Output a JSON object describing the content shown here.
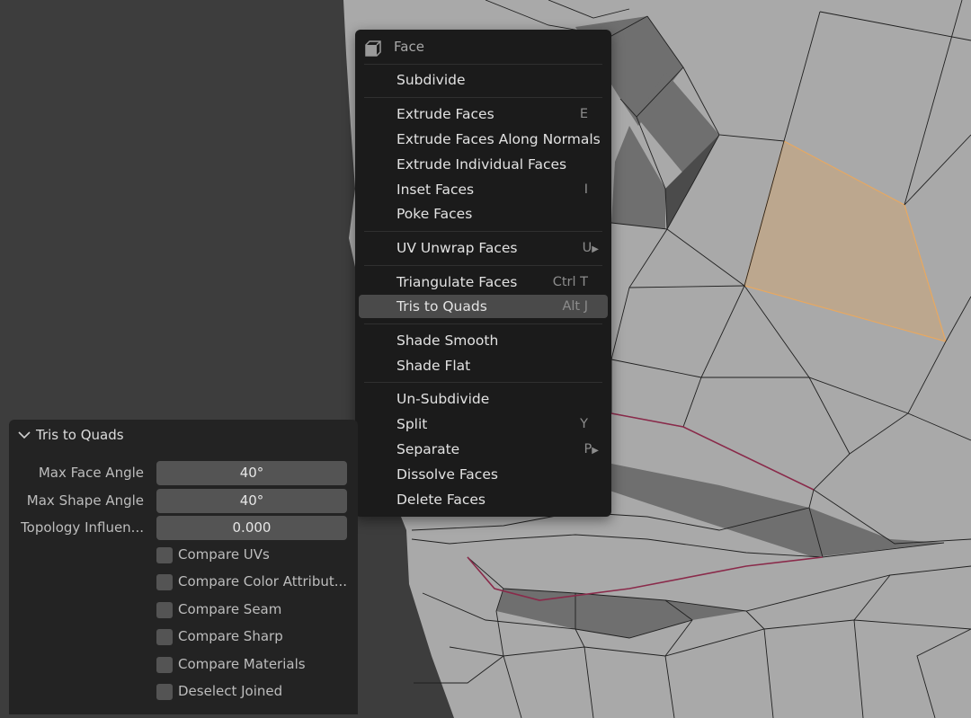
{
  "colors": {
    "viewport_bg": "#3d3d3d",
    "mesh_face": "#a9a9a9",
    "mesh_edge": "#202020",
    "selected_face": "#bca78e",
    "selected_edge": "#e8a860",
    "seam_edge": "#8a2a4a",
    "menu_bg": "#1b1b1b",
    "menu_highlight": "#4a4a4a",
    "panel_bg": "#232323",
    "field_bg": "#545454"
  },
  "menu": {
    "icon": "face-cube-icon",
    "title": "Face",
    "items": [
      {
        "label": "Subdivide",
        "shortcut": ""
      },
      {
        "label": "Extrude Faces",
        "shortcut": "E"
      },
      {
        "label": "Extrude Faces Along Normals",
        "shortcut": ""
      },
      {
        "label": "Extrude Individual Faces",
        "shortcut": ""
      },
      {
        "label": "Inset Faces",
        "shortcut": "I"
      },
      {
        "label": "Poke Faces",
        "shortcut": ""
      },
      {
        "label": "UV Unwrap Faces",
        "shortcut": "U",
        "submenu_icon": "▶"
      },
      {
        "label": "Triangulate Faces",
        "shortcut": "Ctrl T"
      },
      {
        "label": "Tris to Quads",
        "shortcut": "Alt J",
        "highlighted": true
      },
      {
        "label": "Shade Smooth",
        "shortcut": ""
      },
      {
        "label": "Shade Flat",
        "shortcut": ""
      },
      {
        "label": "Un-Subdivide",
        "shortcut": ""
      },
      {
        "label": "Split",
        "shortcut": "Y"
      },
      {
        "label": "Separate",
        "shortcut": "P",
        "submenu_icon": "▶"
      },
      {
        "label": "Dissolve Faces",
        "shortcut": ""
      },
      {
        "label": "Delete Faces",
        "shortcut": ""
      }
    ]
  },
  "panel": {
    "icon": "chevron-down-icon",
    "title": "Tris to Quads",
    "fields": [
      {
        "label": "Max Face Angle",
        "value": "40°"
      },
      {
        "label": "Max Shape Angle",
        "value": "40°"
      },
      {
        "label": "Topology Influen...",
        "value": "0.000"
      }
    ],
    "checkboxes": [
      {
        "label": "Compare UVs",
        "checked": false
      },
      {
        "label": "Compare Color Attribut...",
        "checked": false
      },
      {
        "label": "Compare Seam",
        "checked": false
      },
      {
        "label": "Compare Sharp",
        "checked": false
      },
      {
        "label": "Compare Materials",
        "checked": false
      },
      {
        "label": "Deselect Joined",
        "checked": false
      }
    ]
  }
}
